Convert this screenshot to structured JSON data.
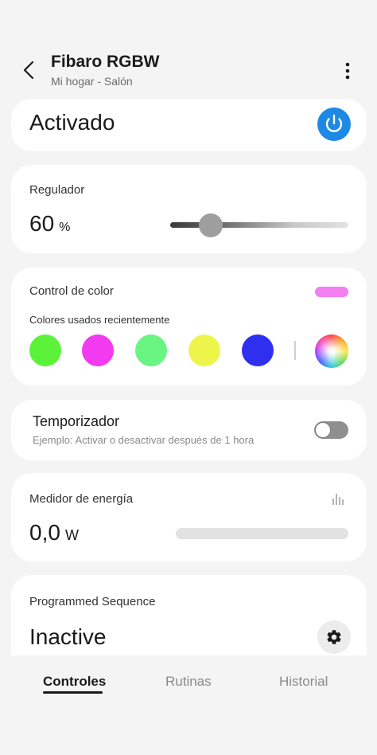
{
  "header": {
    "title": "Fibaro RGBW",
    "subtitle": "Mi hogar - Salón"
  },
  "power_card": {
    "status": "Activado",
    "power_on": true,
    "accent_color": "#1e88e5"
  },
  "dimmer": {
    "label": "Regulador",
    "value": "60",
    "unit": "%",
    "level_percent": 60
  },
  "color_control": {
    "label": "Control de color",
    "current_color": "#f27ef0",
    "recent_label": "Colores usados recientemente",
    "recent_colors": [
      "#5cf23a",
      "#f23af0",
      "#6af582",
      "#eef54a",
      "#2f2ff0"
    ],
    "icons": [
      "color-wheel-icon"
    ]
  },
  "timer": {
    "label": "Temporizador",
    "description": "Ejemplo: Activar o desactivar después de 1 hora",
    "enabled": false
  },
  "energy": {
    "label": "Medidor de energía",
    "value": "0,0",
    "unit": "W",
    "icons": [
      "bar-chart-icon"
    ]
  },
  "sequence": {
    "label": "Programmed Sequence",
    "status": "Inactive",
    "icons": [
      "gear-icon"
    ]
  },
  "tabs": [
    {
      "label": "Controles",
      "active": true
    },
    {
      "label": "Rutinas",
      "active": false
    },
    {
      "label": "Historial",
      "active": false
    }
  ]
}
